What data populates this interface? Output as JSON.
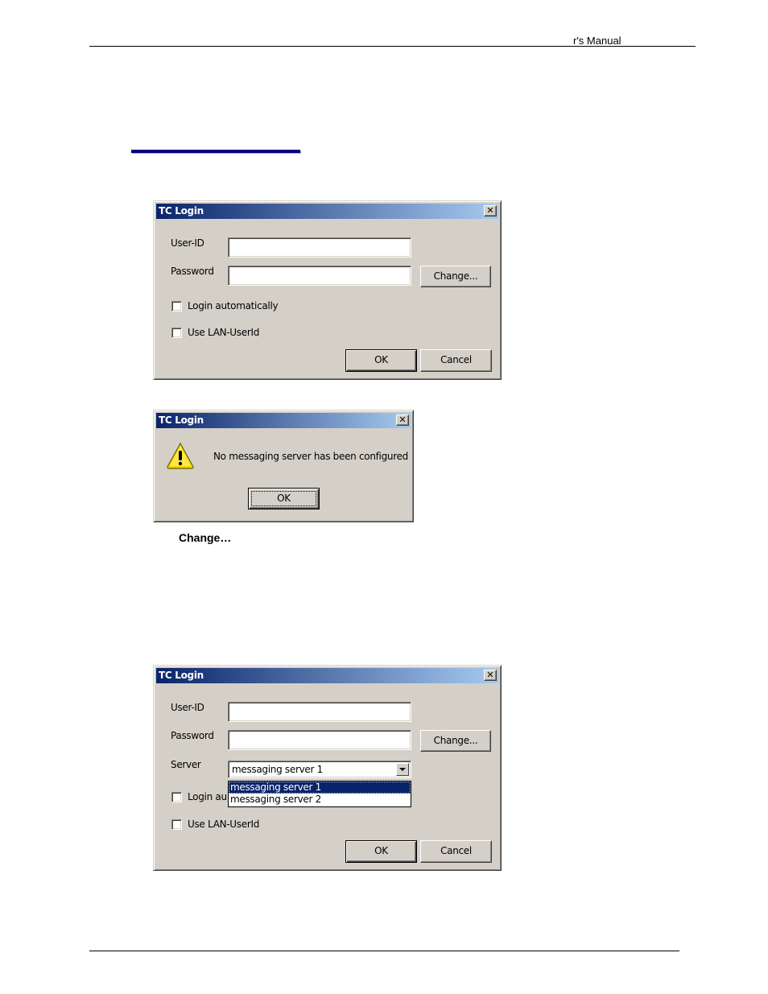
{
  "page": {
    "header_text": "r's Manual",
    "caption_bold": "Change…"
  },
  "dialog1": {
    "title": "TC Login",
    "close_symbol": "✕",
    "userid_label": "User-ID",
    "userid_value": "",
    "password_label": "Password",
    "password_value": "",
    "change_button": "Change...",
    "login_auto_label": "Login automatically",
    "login_auto_checked": false,
    "lan_userid_label": "Use LAN-UserId",
    "lan_userid_checked": false,
    "ok_button": "OK",
    "cancel_button": "Cancel"
  },
  "dialog2": {
    "title": "TC Login",
    "close_symbol": "✕",
    "icon": "warning-icon",
    "message": "No messaging server has been configured",
    "ok_button": "OK"
  },
  "dialog3": {
    "title": "TC Login",
    "close_symbol": "✕",
    "userid_label": "User-ID",
    "userid_value": "",
    "password_label": "Password",
    "password_value": "",
    "change_button": "Change...",
    "server_label": "Server",
    "server_selected": "messaging server 1",
    "server_options": [
      "messaging server 1",
      "messaging server 2"
    ],
    "login_auto_label_partial": "Login au",
    "login_auto_checked": false,
    "lan_userid_label": "Use LAN-UserId",
    "lan_userid_checked": false,
    "ok_button": "OK",
    "cancel_button": "Cancel"
  },
  "colors": {
    "titlebar_start": "#0a246a",
    "titlebar_end": "#a6caf0",
    "dialog_face": "#d4d0c8",
    "section_rule": "#000080",
    "selection": "#0a246a"
  }
}
